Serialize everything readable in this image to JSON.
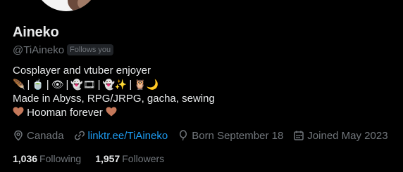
{
  "profile": {
    "display_name": "Aineko",
    "handle": "@TiAineko",
    "follows_you": "Follows you",
    "bio": {
      "line1": "Cosplayer and vtuber enjoyer",
      "emoji_groups": [
        {
          "icon": "feather-icon",
          "glyph": "🪶"
        },
        {
          "icon": "matcha-icon",
          "glyph": "🍵"
        },
        {
          "icon": "eye-icon",
          "glyph": "👁"
        },
        {
          "icon": "ghost-film-icon",
          "glyph": "👻🎞"
        },
        {
          "icon": "ghost-sparkles-icon",
          "glyph": "👻✨"
        },
        {
          "icon": "owl-moon-icon",
          "glyph": "🦉🌙"
        }
      ],
      "line3": "Made in Abyss, RPG/JRPG, gacha, sewing",
      "line4": "Hooman forever"
    },
    "meta": {
      "location": "Canada",
      "link": "linktr.ee/TiAineko",
      "born": "Born September 18",
      "joined": "Joined May 2023"
    },
    "stats": {
      "following_count": "1,036",
      "following_label": "Following",
      "followers_count": "1,957",
      "followers_label": "Followers"
    }
  },
  "colors": {
    "background": "#000000",
    "text_primary": "#e7e9ea",
    "text_secondary": "#71767b",
    "link": "#1d9bf0",
    "heart": "#c4785a"
  }
}
